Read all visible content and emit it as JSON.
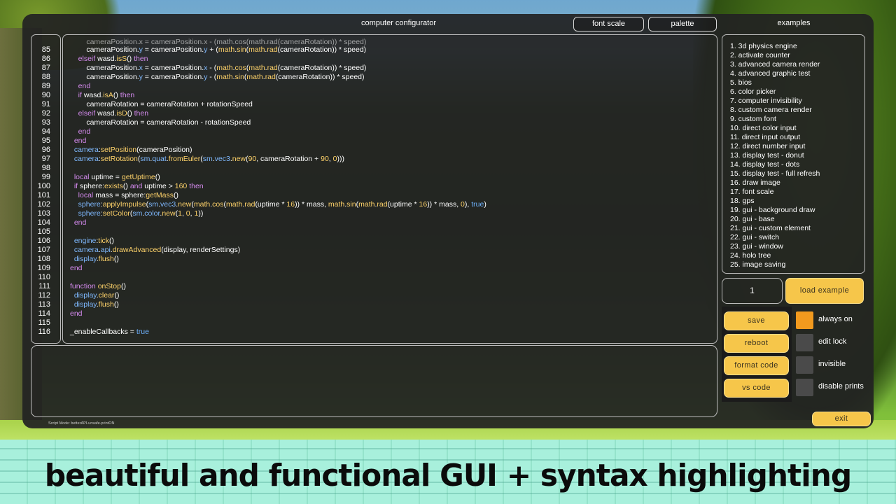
{
  "window": {
    "title": "computer configurator",
    "font_scale_label": "font scale",
    "palette_label": "palette",
    "examples_title": "examples",
    "script_mode": "Script Mode: betterAPI-unsafe-printON"
  },
  "editor": {
    "line_numbers": [
      "85",
      "86",
      "87",
      "88",
      "89",
      "90",
      "91",
      "92",
      "93",
      "94",
      "95",
      "96",
      "97",
      "98",
      "99",
      "100",
      "101",
      "102",
      "103",
      "104",
      "105",
      "106",
      "107",
      "108",
      "109",
      "110",
      "111",
      "112",
      "113",
      "114",
      "115",
      "116"
    ]
  },
  "examples": {
    "items": [
      "1. 3d physics engine",
      "2. activate counter",
      "3. advanced camera render",
      "4. advanced graphic test",
      "5. bios",
      "6. color picker",
      "7. computer invisibility",
      "8. custom camera render",
      "9. custom font",
      "10. direct color input",
      "11. direct input output",
      "12. direct number input",
      "13. display test - donut",
      "14. display test - dots",
      "15. display test - full refresh",
      "16. draw image",
      "17. font scale",
      "18. gps",
      "19. gui - background draw",
      "20. gui - base",
      "21. gui - custom element",
      "22. gui - switch",
      "23. gui - window",
      "24. holo tree",
      "25. image saving"
    ],
    "selected_number": "1",
    "load_label": "load example"
  },
  "actions": {
    "save": "save",
    "reboot": "reboot",
    "format_code": "format code",
    "vs_code": "vs code",
    "exit": "exit"
  },
  "toggles": [
    {
      "label": "always on",
      "state": "on"
    },
    {
      "label": "edit lock",
      "state": "off"
    },
    {
      "label": "invisible",
      "state": "off"
    },
    {
      "label": "disable prints",
      "state": "off"
    }
  ],
  "banner": {
    "text": "beautiful and functional GUI + syntax highlighting"
  },
  "colors": {
    "keyword": "#d68bf0",
    "function": "#ffd36a",
    "property": "#7fb9ff",
    "button": "#f6c64a",
    "toggle_on": "#f29a1e",
    "toggle_off": "#4a4a4a"
  }
}
